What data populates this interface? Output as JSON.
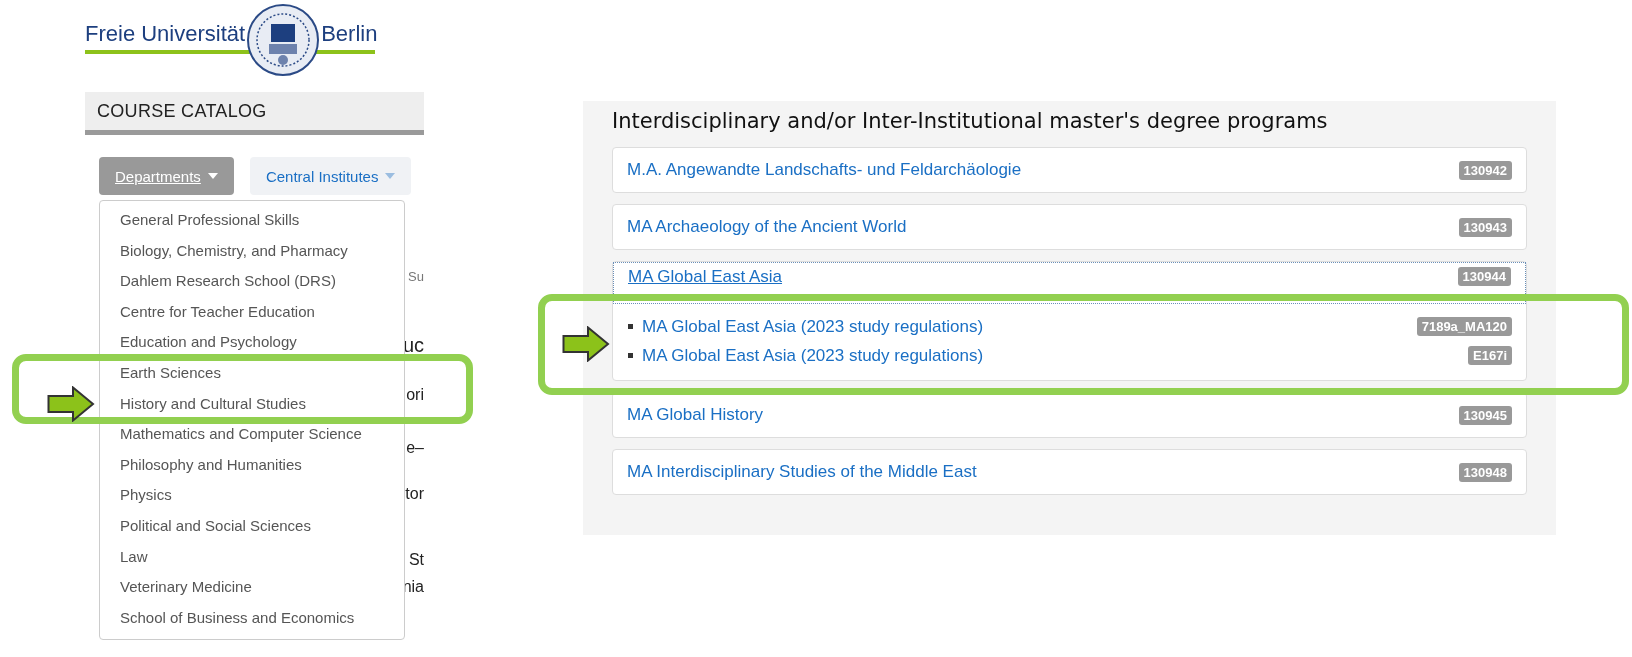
{
  "logo": {
    "left": "Freie Universität",
    "right": "Berlin"
  },
  "catalog_title": "COURSE CATALOG",
  "nav": [
    {
      "label": "Departments",
      "selected": true
    },
    {
      "label": "Central Institutes",
      "selected": false
    }
  ],
  "dropdown": {
    "items": [
      "General Professional Skills",
      "Biology, Chemistry, and Pharmacy",
      "Dahlem Research School (DRS)",
      "Centre for Teacher Education",
      "Education and Psychology",
      "Earth Sciences",
      "History and Cultural Studies",
      "Mathematics and Computer Science",
      "Philosophy and Humanities",
      "Physics",
      "Political and Social Sciences",
      "Law",
      "Veterinary Medicine",
      "School of Business and Economics"
    ]
  },
  "background_fragments": [
    "Su",
    "uc",
    "ori",
    "e–",
    "tor",
    "St",
    "nia"
  ],
  "programs": {
    "title": "Interdisciplinary and/or Inter-Institutional master's degree programs",
    "items": [
      {
        "label": "M.A. Angewandte Landschafts- und Feldarchäologie",
        "code": "130942",
        "focused": false
      },
      {
        "label": "MA Archaeology of the Ancient World",
        "code": "130943",
        "focused": false
      },
      {
        "label": "MA Global East Asia",
        "code": "130944",
        "focused": true,
        "children": [
          {
            "label": "MA Global East Asia (2023 study regulations)",
            "code": "7189a_MA120"
          },
          {
            "label": "MA Global East Asia (2023 study regulations)",
            "code": "E167i"
          }
        ]
      },
      {
        "label": "MA Global History",
        "code": "130945",
        "focused": false
      },
      {
        "label": "MA Interdisciplinary Studies of the Middle East",
        "code": "130948",
        "focused": false
      }
    ]
  },
  "highlights": [
    {
      "kind": "frame-with-arrow"
    },
    {
      "kind": "frame-with-arrow"
    }
  ]
}
